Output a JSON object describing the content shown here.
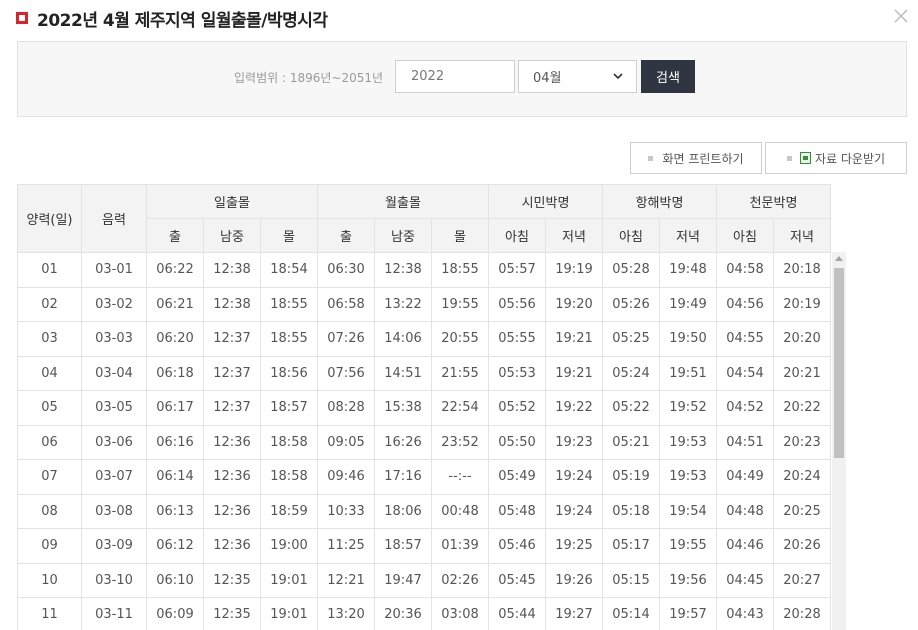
{
  "header": {
    "title": "2022년 4월 제주지역 일월출몰/박명시각"
  },
  "search": {
    "range_label": "입력범위 : 1896년~2051년",
    "year_value": "2022",
    "month_value": "04월",
    "search_label": "검색"
  },
  "toolbar": {
    "print_label": "화면 프린트하기",
    "download_label": "자료 다운받기"
  },
  "table": {
    "col_solar": "양력(일)",
    "col_lunar": "음력",
    "groups": {
      "sun": "일출몰",
      "moon": "월출몰",
      "civil": "시민박명",
      "nautical": "항해박명",
      "astro": "천문박명"
    },
    "sub": {
      "rise": "출",
      "transit": "남중",
      "set": "몰",
      "morning": "아침",
      "evening": "저녁"
    },
    "rows": [
      [
        "01",
        "03-01",
        "06:22",
        "12:38",
        "18:54",
        "06:30",
        "12:38",
        "18:55",
        "05:57",
        "19:19",
        "05:28",
        "19:48",
        "04:58",
        "20:18"
      ],
      [
        "02",
        "03-02",
        "06:21",
        "12:38",
        "18:55",
        "06:58",
        "13:22",
        "19:55",
        "05:56",
        "19:20",
        "05:26",
        "19:49",
        "04:56",
        "20:19"
      ],
      [
        "03",
        "03-03",
        "06:20",
        "12:37",
        "18:55",
        "07:26",
        "14:06",
        "20:55",
        "05:55",
        "19:21",
        "05:25",
        "19:50",
        "04:55",
        "20:20"
      ],
      [
        "04",
        "03-04",
        "06:18",
        "12:37",
        "18:56",
        "07:56",
        "14:51",
        "21:55",
        "05:53",
        "19:21",
        "05:24",
        "19:51",
        "04:54",
        "20:21"
      ],
      [
        "05",
        "03-05",
        "06:17",
        "12:37",
        "18:57",
        "08:28",
        "15:38",
        "22:54",
        "05:52",
        "19:22",
        "05:22",
        "19:52",
        "04:52",
        "20:22"
      ],
      [
        "06",
        "03-06",
        "06:16",
        "12:36",
        "18:58",
        "09:05",
        "16:26",
        "23:52",
        "05:50",
        "19:23",
        "05:21",
        "19:53",
        "04:51",
        "20:23"
      ],
      [
        "07",
        "03-07",
        "06:14",
        "12:36",
        "18:58",
        "09:46",
        "17:16",
        "--:--",
        "05:49",
        "19:24",
        "05:19",
        "19:53",
        "04:49",
        "20:24"
      ],
      [
        "08",
        "03-08",
        "06:13",
        "12:36",
        "18:59",
        "10:33",
        "18:06",
        "00:48",
        "05:48",
        "19:24",
        "05:18",
        "19:54",
        "04:48",
        "20:25"
      ],
      [
        "09",
        "03-09",
        "06:12",
        "12:36",
        "19:00",
        "11:25",
        "18:57",
        "01:39",
        "05:46",
        "19:25",
        "05:17",
        "19:55",
        "04:46",
        "20:26"
      ],
      [
        "10",
        "03-10",
        "06:10",
        "12:35",
        "19:01",
        "12:21",
        "19:47",
        "02:26",
        "05:45",
        "19:26",
        "05:15",
        "19:56",
        "04:45",
        "20:27"
      ],
      [
        "11",
        "03-11",
        "06:09",
        "12:35",
        "19:01",
        "13:20",
        "20:36",
        "03:08",
        "05:44",
        "19:27",
        "05:14",
        "19:57",
        "04:43",
        "20:28"
      ]
    ]
  },
  "colors": {
    "title_marker": "#d6262c",
    "search_button": "#2f3541",
    "header_bg": "#f3f3f3"
  },
  "icons": {
    "close": "close-icon",
    "select": "chevron-down-icon",
    "download": "excel-file-icon"
  }
}
